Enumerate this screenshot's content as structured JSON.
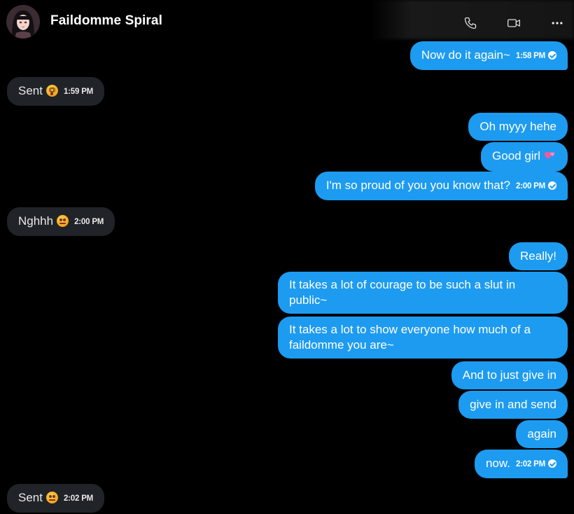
{
  "header": {
    "contact_name": "Faildomme Spiral",
    "call_icon": "phone-icon",
    "video_icon": "video-icon",
    "more_icon": "more-icon"
  },
  "messages": [
    {
      "dir": "out",
      "text": "Now do it again~",
      "time": "1:58 PM",
      "read": true
    },
    {
      "dir": "in",
      "text": "Sent",
      "emoji": "dizzy-face",
      "time": "1:59 PM"
    },
    {
      "dir": "out",
      "text": "Oh myyy hehe"
    },
    {
      "dir": "out",
      "text": "Good girl",
      "emoji": "two-hearts"
    },
    {
      "dir": "out",
      "text": "I'm so proud of you you know that?",
      "time": "2:00 PM",
      "read": true
    },
    {
      "dir": "in",
      "text": "Nghhh",
      "emoji": "drooling-face",
      "time": "2:00 PM"
    },
    {
      "dir": "out",
      "text": "Really!"
    },
    {
      "dir": "out",
      "text": "It takes a lot of courage to be such a slut in public~"
    },
    {
      "dir": "out",
      "text": "It takes a lot to show everyone how much of a faildomme you are~"
    },
    {
      "dir": "out",
      "text": "And to just give in"
    },
    {
      "dir": "out",
      "text": "give in and send"
    },
    {
      "dir": "out",
      "text": "again"
    },
    {
      "dir": "out",
      "text": "now.",
      "time": "2:02 PM",
      "read": true
    },
    {
      "dir": "in",
      "text": "Sent",
      "emoji": "drooling-face",
      "time": "2:02 PM"
    }
  ],
  "colors": {
    "background": "#000000",
    "outgoing_bubble": "#1d9bf0",
    "incoming_bubble": "#202327",
    "text": "#ffffff"
  }
}
